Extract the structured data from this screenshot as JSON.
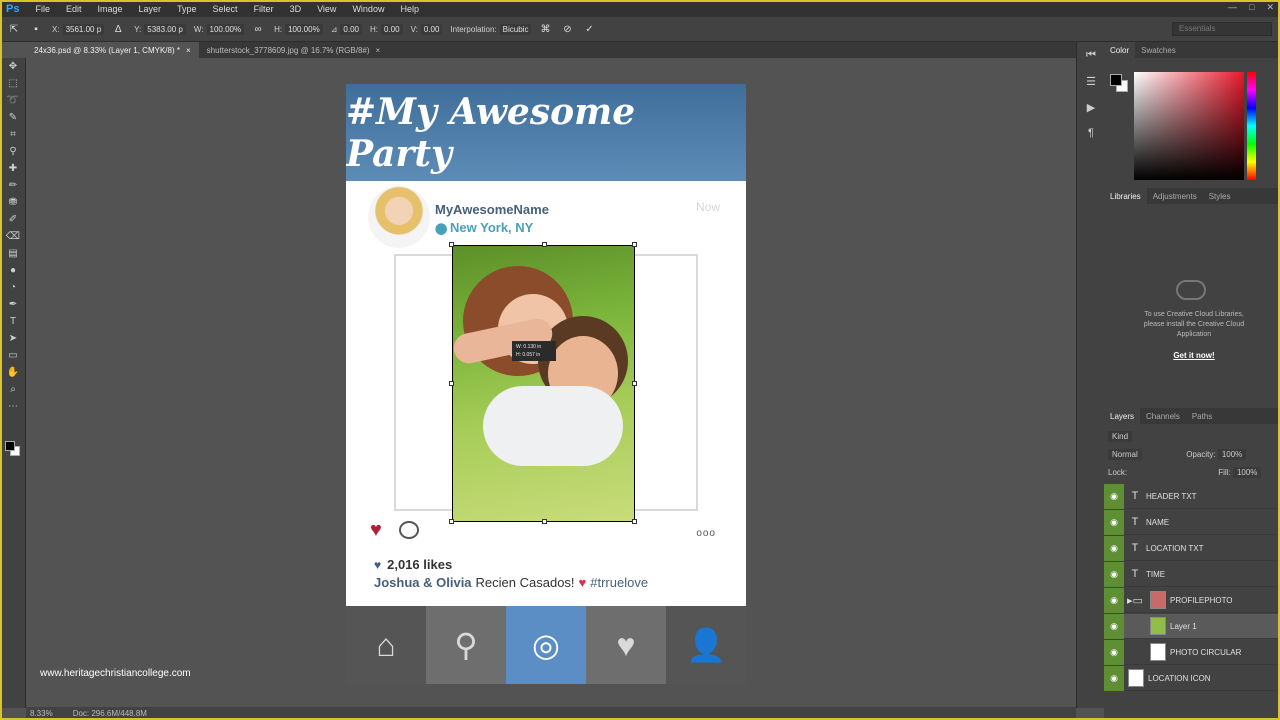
{
  "app": {
    "logo": "Ps"
  },
  "menu": [
    "File",
    "Edit",
    "Image",
    "Layer",
    "Type",
    "Select",
    "Filter",
    "3D",
    "View",
    "Window",
    "Help"
  ],
  "window_controls": [
    "—",
    "□",
    "✕"
  ],
  "options": {
    "x_label": "X:",
    "x_value": "3561.00 p",
    "y_label": "Y:",
    "y_value": "5383.00 p",
    "w_label": "W:",
    "w_value": "100.00%",
    "h_label": "H:",
    "h_value": "100.00%",
    "angle_value": "0.00",
    "hskew_label": "H:",
    "hskew_value": "0.00",
    "vskew_label": "V:",
    "vskew_value": "0.00",
    "interp_label": "Interpolation:",
    "interp_value": "Bicubic",
    "workspace": "Essentials"
  },
  "tabs": [
    {
      "label": "24x36.psd @ 8.33% (Layer 1, CMYK/8) *",
      "close": "×"
    },
    {
      "label": "shutterstock_3778609.jpg @ 16.7% (RGB/8#)",
      "close": "×"
    }
  ],
  "document": {
    "header_title": "#My Awesome Party",
    "username": "MyAwesomeName",
    "location": "New York, NY",
    "time": "Now",
    "tooltip_line1": "W: 0.130 in",
    "tooltip_line2": "H: 0.057 in",
    "more": "ooo",
    "likes": "2,016 likes",
    "caption_names": "Joshua & Olivia",
    "caption_text": "Recien Casados!",
    "caption_tag": "#trruelove",
    "nav": [
      "home-icon",
      "search-icon",
      "camera-icon",
      "heart-chat-icon",
      "profile-icon"
    ],
    "nav_colors": [
      "#555555",
      "#6e6e6e",
      "#5b8ec4",
      "#6e6e6e",
      "#555555"
    ],
    "header_color": "#4a78a4"
  },
  "watermark": "www.heritagechristiancollege.com",
  "status": {
    "zoom": "8.33%",
    "doc": "Doc: 296.6M/448.8M"
  },
  "panels": {
    "color_tabs": [
      "Color",
      "Swatches"
    ],
    "lib_tabs": [
      "Libraries",
      "Adjustments",
      "Styles"
    ],
    "lib_message": "To use Creative Cloud Libraries, please install the Creative Cloud Application",
    "lib_cta": "Get it now!",
    "layer_tabs": [
      "Layers",
      "Channels",
      "Paths"
    ],
    "kind": "Kind",
    "blend": "Normal",
    "opacity_label": "Opacity:",
    "opacity": "100%",
    "lock_label": "Lock:",
    "fill_label": "Fill:",
    "fill": "100%",
    "layers": [
      {
        "name": "HEADER TXT",
        "type": "T"
      },
      {
        "name": "NAME",
        "type": "T"
      },
      {
        "name": "LOCATION TXT",
        "type": "T"
      },
      {
        "name": "TIME",
        "type": "T"
      },
      {
        "name": "PROFILEPHOTO",
        "type": "group"
      },
      {
        "name": "Layer 1",
        "type": "pixel"
      },
      {
        "name": "PHOTO CIRCULAR",
        "type": "pixel"
      },
      {
        "name": "LOCATION ICON",
        "type": "pixel"
      }
    ]
  }
}
